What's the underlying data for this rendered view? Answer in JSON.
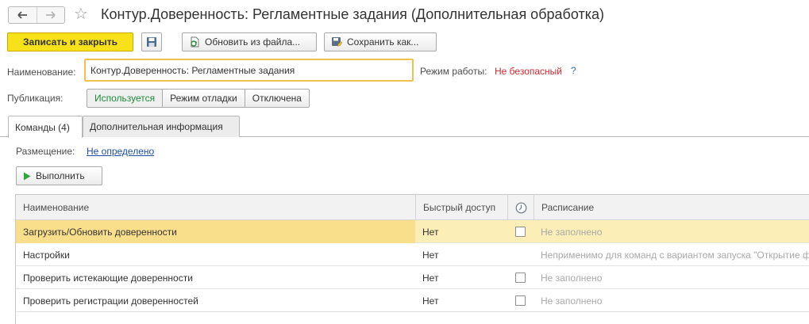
{
  "window": {
    "title": "Контур.Доверенность: Регламентные задания (Дополнительная обработка)"
  },
  "toolbar": {
    "save_close_label": "Записать и закрыть",
    "load_file_label": "Обновить из файла...",
    "save_as_label": "Сохранить как..."
  },
  "form": {
    "name_label": "Наименование:",
    "name_value": "Контур.Доверенность: Регламентные задания",
    "mode_label": "Режим работы:",
    "mode_value": "Не безопасный",
    "help_label": "?",
    "publication_label": "Публикация:",
    "publication_options": [
      "Используется",
      "Режим отладки",
      "Отключена"
    ],
    "publication_selected": "Используется"
  },
  "tabs": [
    {
      "label": "Команды (4)",
      "active": true
    },
    {
      "label": "Дополнительная информация",
      "active": false
    }
  ],
  "commands": {
    "placement_label": "Размещение:",
    "placement_value": "Не определено",
    "run_label": "Выполнить",
    "columns": [
      "Наименование",
      "Быстрый доступ",
      "",
      "Расписание"
    ],
    "rows": [
      {
        "name": "Загрузить/Обновить доверенности",
        "quick": "Нет",
        "checkbox": true,
        "schedule": "Не заполнено",
        "selected": true
      },
      {
        "name": "Настройки",
        "quick": "Нет",
        "checkbox": false,
        "schedule": "Неприменимо для команд с вариантом запуска \"Открытие формы\"",
        "selected": false
      },
      {
        "name": "Проверить истекающие доверенности",
        "quick": "Нет",
        "checkbox": true,
        "schedule": "Не заполнено",
        "selected": false
      },
      {
        "name": "Проверить регистрации доверенностей",
        "quick": "Нет",
        "checkbox": true,
        "schedule": "Не заполнено",
        "selected": false
      }
    ]
  },
  "colors": {
    "primary_button": "#f7e21a",
    "selected_row": "#fbeeb6",
    "active_publication": "#1d8a3a",
    "mode_warning": "#d8262c",
    "link": "#1f4fa8"
  },
  "icons": {
    "back": "arrow-left-icon",
    "forward": "arrow-right-icon",
    "favorite": "star-icon",
    "save": "floppy-icon",
    "load": "file-refresh-icon",
    "save_as": "save-as-icon",
    "run": "play-icon",
    "schedule": "clock-icon"
  }
}
